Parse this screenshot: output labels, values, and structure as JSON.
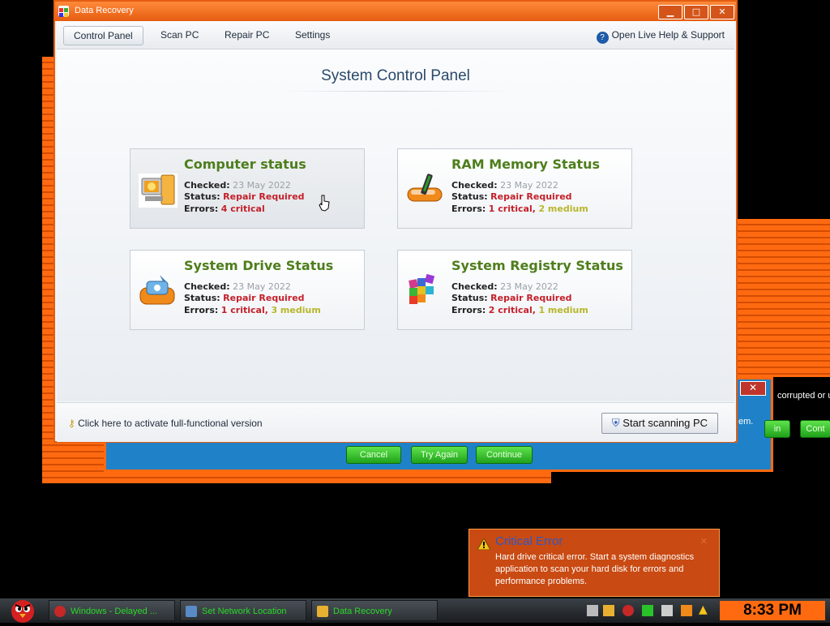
{
  "window": {
    "title": "Data Recovery",
    "controls": [
      "minimize",
      "maximize",
      "close"
    ]
  },
  "menu": {
    "tabs": [
      "Control Panel",
      "Scan PC",
      "Repair PC",
      "Settings"
    ],
    "active_tab": "Control Panel",
    "help_label": "Open Live Help & Support"
  },
  "page": {
    "title": "System Control Panel"
  },
  "cards": [
    {
      "title": "Computer status",
      "icon": "computer-icon",
      "checked_label": "Checked:",
      "checked_date": "23 May 2022",
      "status_label": "Status:",
      "status_value": "Repair Required",
      "errors_label": "Errors:",
      "errors_critical": "4 critical",
      "errors_sep": "",
      "errors_medium": ""
    },
    {
      "title": "RAM Memory Status",
      "icon": "ram-memory-icon",
      "checked_label": "Checked:",
      "checked_date": "23 May 2022",
      "status_label": "Status:",
      "status_value": "Repair Required",
      "errors_label": "Errors:",
      "errors_critical": "1 critical",
      "errors_sep": ",",
      "errors_medium": "2 medium"
    },
    {
      "title": "System Drive Status",
      "icon": "system-drive-icon",
      "checked_label": "Checked:",
      "checked_date": "23 May 2022",
      "status_label": "Status:",
      "status_value": "Repair Required",
      "errors_label": "Errors:",
      "errors_critical": "1 critical",
      "errors_sep": ",",
      "errors_medium": "3 medium"
    },
    {
      "title": "System Registry Status",
      "icon": "registry-icon",
      "checked_label": "Checked:",
      "checked_date": "23 May 2022",
      "status_label": "Status:",
      "status_value": "Repair Required",
      "errors_label": "Errors:",
      "errors_critical": "2 critical",
      "errors_sep": ",",
      "errors_medium": "1 medium"
    }
  ],
  "footer": {
    "activate_text": "Click here to activate full-functional version",
    "scan_button": "Start scanning PC"
  },
  "background_dialog": {
    "buttons": [
      "Cancel",
      "Try Again",
      "Continue"
    ],
    "side_text_1": "corrupted or u",
    "side_text_2": "em.",
    "side_btn_1": "in",
    "side_btn_2": "Cont"
  },
  "notification": {
    "title": "Critical Error",
    "body": "Hard drive critical error. Start a system diagnostics application to scan your hard disk for errors and performance problems."
  },
  "taskbar": {
    "items": [
      "Windows - Delayed ...",
      "Set Network Location",
      "Data Recovery"
    ],
    "clock": "8:33 PM"
  },
  "colors": {
    "accent_orange": "#ff6a10",
    "title_green": "#4e7e1c",
    "critical_red": "#c4202a",
    "medium_yellow": "#b8b62b"
  }
}
